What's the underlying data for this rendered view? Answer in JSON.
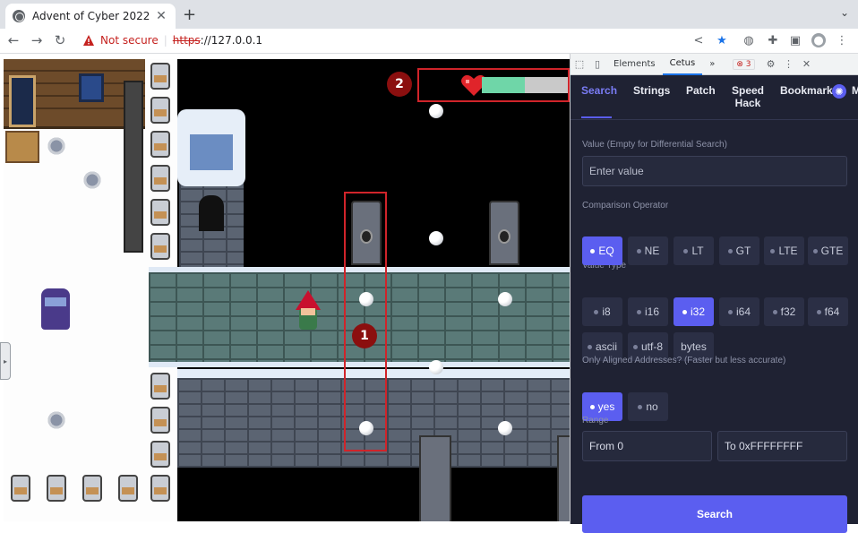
{
  "browser": {
    "tab_title": "Advent of Cyber 2022",
    "tab_close": "✕",
    "new_tab": "+",
    "tab_menu": "⌄",
    "security_label": "Not secure",
    "url_scheme": "https",
    "url_rest": "://127.0.0.1"
  },
  "game": {
    "annotation_1": "1",
    "annotation_2": "2",
    "health_fraction": 0.5
  },
  "devtools": {
    "tabs": [
      "Elements",
      "Cetus"
    ],
    "more_tabs": "»",
    "error_count": "3"
  },
  "cetus": {
    "nav": [
      "Search",
      "Strings",
      "Patch",
      "Speed Hack",
      "Bookmark"
    ],
    "nav_clipped": "M",
    "value_label": "Value (Empty for Differential Search)",
    "value_placeholder": "Enter value",
    "comparison_label": "Comparison Operator",
    "operators": [
      "EQ",
      "NE",
      "LT",
      "GT",
      "LTE",
      "GTE"
    ],
    "operator_selected": "EQ",
    "value_type_label": "Value Type",
    "types_row1": [
      "i8",
      "i16",
      "i32",
      "i64",
      "f32",
      "f64"
    ],
    "types_row2": [
      "ascii",
      "utf-8",
      "bytes"
    ],
    "type_selected": "i32",
    "aligned_label": "Only Aligned Addresses? (Faster but less accurate)",
    "aligned_options": [
      "yes",
      "no"
    ],
    "aligned_selected": "yes",
    "range_label": "Range",
    "range_from": "From 0",
    "range_to": "To 0xFFFFFFFF",
    "search_button": "Search"
  },
  "colors": {
    "accent": "#5b5ef0",
    "panel_bg": "#1f2233",
    "annotation_red": "#d0242a"
  }
}
